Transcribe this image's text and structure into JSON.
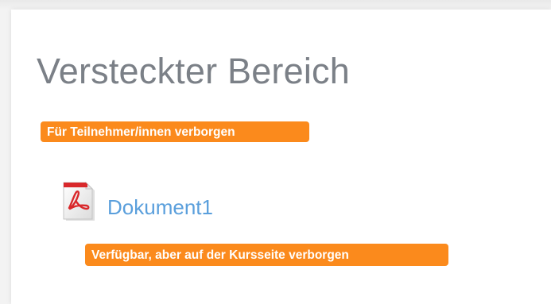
{
  "section": {
    "title": "Versteckter Bereich",
    "hidden_badge": "Für Teilnehmer/innen verborgen"
  },
  "activity": {
    "icon": "pdf-file-icon",
    "link_label": "Dokument1",
    "availability_badge": "Verfügbar, aber auf der Kursseite verborgen"
  },
  "colors": {
    "badge": "#fb8a1c",
    "title": "#7b8087",
    "link": "#5a9fdc",
    "pdf_red": "#d9282b"
  }
}
